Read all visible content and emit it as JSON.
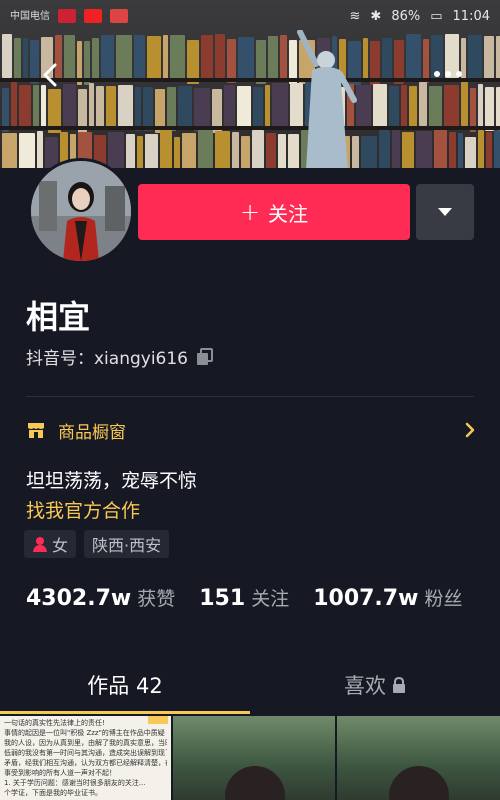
{
  "status_bar": {
    "carrier": "中国电信",
    "battery": "86%",
    "time": "11:04"
  },
  "profile": {
    "follow_label": "关注",
    "follow_plus": "+",
    "name": "相宜",
    "douyin_id": "抖音号：xiangyi616",
    "shop_label": "商品橱窗",
    "bio_line": "坦坦荡荡，宠辱不惊",
    "bio_link": "找我官方合作",
    "gender_tag": "女",
    "location_tag": "陕西·西安"
  },
  "stats": [
    {
      "value": "4302.7w",
      "label": "获赞"
    },
    {
      "value": "151",
      "label": "关注"
    },
    {
      "value": "1007.7w",
      "label": "粉丝"
    }
  ],
  "tabs": [
    {
      "label": "作品 42"
    },
    {
      "label": "喜欢"
    }
  ],
  "grid": {
    "doc_lines": [
      "一句话的真实性先法律上的责任!",
      "事情的起因是一位叫\"积极 Zzz\"的博主在作品中质疑",
      "我的人设，因为从真到里，由解了我的真实意思，当时心性",
      "低弱的我没有第一时间与其沟通，造成突出误解到现了一些",
      "矛盾，经我们相互沟通，认为双方都已经解释清楚，在此要向",
      "事受到影响的所有人道一声对不起！",
      "1. 关于学历问题：感谢当时很多朋友的关注...",
      "个学证，下面是我的毕业证书。"
    ]
  },
  "colors": {
    "accent_red": "#fe2c55",
    "accent_gold": "#f7c853",
    "background": "#161823"
  }
}
